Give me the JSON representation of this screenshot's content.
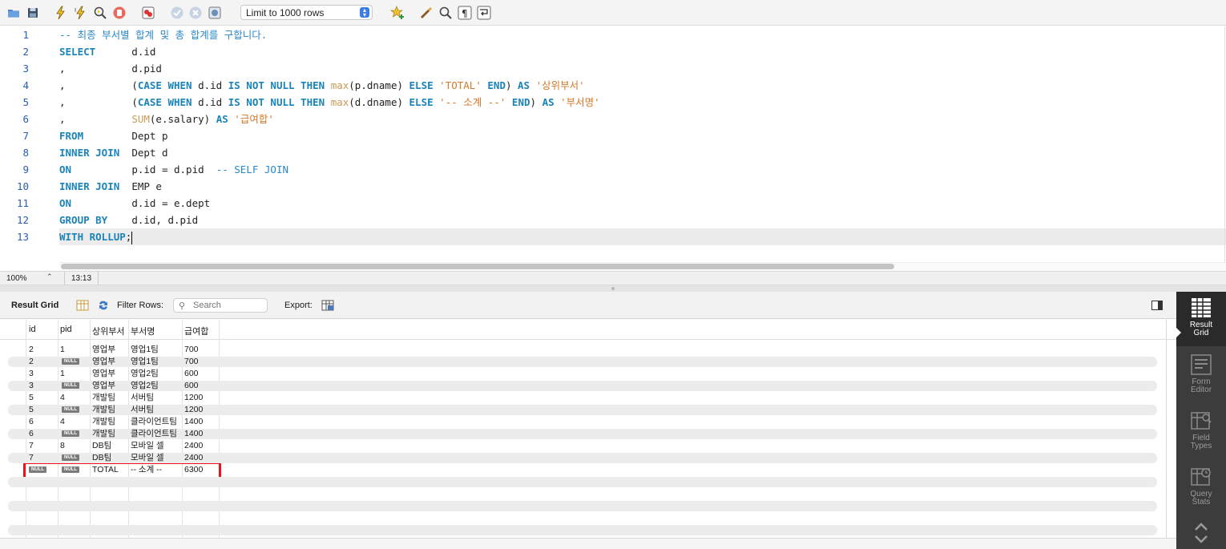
{
  "toolbar": {
    "limit_select": "Limit to 1000 rows",
    "icons": [
      "open-folder-icon",
      "save-icon",
      "execute-icon",
      "execute-current-icon",
      "explain-icon",
      "stop-icon",
      "toggle-error-icon",
      "commit-icon",
      "rollback-icon",
      "autocommit-icon",
      "bookmark-star-icon",
      "beautify-icon",
      "find-icon",
      "invisible-chars-icon",
      "wrap-icon"
    ]
  },
  "editor": {
    "lines": [
      {
        "n": "1",
        "parts": [
          {
            "t": "-- 최종 부서별 합계 및 총 합계를 구합니다.",
            "c": "cm"
          }
        ]
      },
      {
        "n": "2",
        "parts": [
          {
            "t": "SELECT",
            "c": "kw"
          },
          {
            "t": "      d.id",
            "c": ""
          }
        ]
      },
      {
        "n": "3",
        "parts": [
          {
            "t": ",",
            "c": ""
          },
          {
            "t": "           d.pid",
            "c": ""
          }
        ]
      },
      {
        "n": "4",
        "parts": [
          {
            "t": ",",
            "c": ""
          },
          {
            "t": "           (",
            "c": ""
          },
          {
            "t": "CASE WHEN",
            "c": "kw"
          },
          {
            "t": " d.id ",
            "c": ""
          },
          {
            "t": "IS NOT NULL THEN",
            "c": "kw"
          },
          {
            "t": " ",
            "c": ""
          },
          {
            "t": "max",
            "c": "fn"
          },
          {
            "t": "(p.dname) ",
            "c": ""
          },
          {
            "t": "ELSE",
            "c": "kw"
          },
          {
            "t": " ",
            "c": ""
          },
          {
            "t": "'TOTAL'",
            "c": "st"
          },
          {
            "t": " ",
            "c": ""
          },
          {
            "t": "END",
            "c": "kw"
          },
          {
            "t": ") ",
            "c": ""
          },
          {
            "t": "AS",
            "c": "kw"
          },
          {
            "t": " ",
            "c": ""
          },
          {
            "t": "'상위부서'",
            "c": "st"
          }
        ]
      },
      {
        "n": "5",
        "parts": [
          {
            "t": ",",
            "c": ""
          },
          {
            "t": "           (",
            "c": ""
          },
          {
            "t": "CASE WHEN",
            "c": "kw"
          },
          {
            "t": " d.id ",
            "c": ""
          },
          {
            "t": "IS NOT NULL THEN",
            "c": "kw"
          },
          {
            "t": " ",
            "c": ""
          },
          {
            "t": "max",
            "c": "fn"
          },
          {
            "t": "(d.dname) ",
            "c": ""
          },
          {
            "t": "ELSE",
            "c": "kw"
          },
          {
            "t": " ",
            "c": ""
          },
          {
            "t": "'-- 소계 --'",
            "c": "st"
          },
          {
            "t": " ",
            "c": ""
          },
          {
            "t": "END",
            "c": "kw"
          },
          {
            "t": ") ",
            "c": ""
          },
          {
            "t": "AS",
            "c": "kw"
          },
          {
            "t": " ",
            "c": ""
          },
          {
            "t": "'부서명'",
            "c": "st"
          }
        ]
      },
      {
        "n": "6",
        "parts": [
          {
            "t": ",",
            "c": ""
          },
          {
            "t": "           ",
            "c": ""
          },
          {
            "t": "SUM",
            "c": "fn"
          },
          {
            "t": "(e.salary) ",
            "c": ""
          },
          {
            "t": "AS",
            "c": "kw"
          },
          {
            "t": " ",
            "c": ""
          },
          {
            "t": "'급여합'",
            "c": "st"
          }
        ]
      },
      {
        "n": "7",
        "parts": [
          {
            "t": "FROM",
            "c": "kw"
          },
          {
            "t": "        Dept p",
            "c": ""
          }
        ]
      },
      {
        "n": "8",
        "parts": [
          {
            "t": "INNER JOIN",
            "c": "kw"
          },
          {
            "t": "  Dept d",
            "c": ""
          }
        ]
      },
      {
        "n": "9",
        "parts": [
          {
            "t": "ON",
            "c": "kw"
          },
          {
            "t": "          p.id = d.pid  ",
            "c": ""
          },
          {
            "t": "-- SELF JOIN",
            "c": "cm"
          }
        ]
      },
      {
        "n": "10",
        "parts": [
          {
            "t": "INNER JOIN",
            "c": "kw"
          },
          {
            "t": "  EMP e",
            "c": ""
          }
        ]
      },
      {
        "n": "11",
        "parts": [
          {
            "t": "ON",
            "c": "kw"
          },
          {
            "t": "          d.id = e.dept",
            "c": ""
          }
        ]
      },
      {
        "n": "12",
        "parts": [
          {
            "t": "GROUP BY",
            "c": "kw"
          },
          {
            "t": "    d.id, d.pid",
            "c": ""
          }
        ]
      },
      {
        "n": "13",
        "parts": [
          {
            "t": "WITH ROLLUP",
            "c": "kw"
          },
          {
            "t": ";",
            "c": ""
          }
        ]
      }
    ]
  },
  "status": {
    "zoom": "100%",
    "cursor_position": "13:13"
  },
  "result_header": {
    "title": "Result Grid",
    "filter_label": "Filter Rows:",
    "search_placeholder": "Search",
    "export_label": "Export:"
  },
  "grid": {
    "columns": [
      "id",
      "pid",
      "상위부서",
      "부서명",
      "급여합"
    ],
    "null_label": "NULL",
    "rows": [
      [
        "2",
        "1",
        "영업부",
        "영업1팀",
        "700"
      ],
      [
        "2",
        null,
        "영업부",
        "영업1팀",
        "700"
      ],
      [
        "3",
        "1",
        "영업부",
        "영업2팀",
        "600"
      ],
      [
        "3",
        null,
        "영업부",
        "영업2팀",
        "600"
      ],
      [
        "5",
        "4",
        "개발팀",
        "서버팀",
        "1200"
      ],
      [
        "5",
        null,
        "개발팀",
        "서버팀",
        "1200"
      ],
      [
        "6",
        "4",
        "개발팀",
        "클라이언트팀",
        "1400"
      ],
      [
        "6",
        null,
        "개발팀",
        "클라이언트팀",
        "1400"
      ],
      [
        "7",
        "8",
        "DB팀",
        "모바일 셀",
        "2400"
      ],
      [
        "7",
        null,
        "DB팀",
        "모바일 셀",
        "2400"
      ],
      [
        null,
        null,
        "TOTAL",
        "-- 소계 --",
        "6300"
      ]
    ],
    "highlighted_row": 10,
    "highlight_color": "#e8161c"
  },
  "sidebar": {
    "items": [
      {
        "label1": "Result",
        "label2": "Grid",
        "icon": "result-grid-icon",
        "active": true
      },
      {
        "label1": "Form",
        "label2": "Editor",
        "icon": "form-editor-icon",
        "active": false
      },
      {
        "label1": "Field",
        "label2": "Types",
        "icon": "field-types-icon",
        "active": false
      },
      {
        "label1": "Query",
        "label2": "Stats",
        "icon": "query-stats-icon",
        "active": false
      }
    ]
  }
}
